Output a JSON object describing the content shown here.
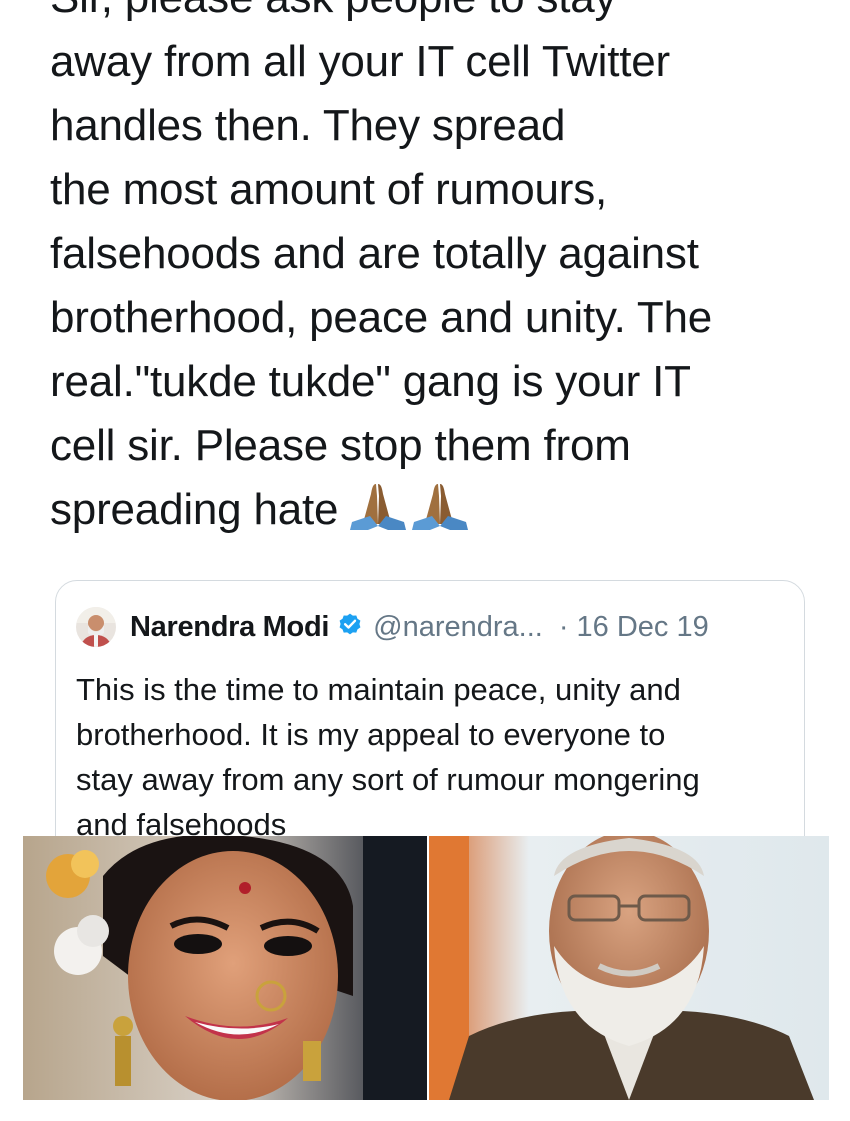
{
  "main_tweet": {
    "lines": [
      "Sir, please ask people to stay",
      "away from all your IT cell Twitter",
      "handles then. They spread",
      "the most amount of rumours,",
      "falsehoods and are totally against",
      "brotherhood, peace and unity. The",
      "real.\"tukde tukde\" gang is your IT",
      "cell sir. Please stop them from",
      "spreading hate"
    ],
    "emoji": "folded-hands-icon",
    "emoji_count": 2
  },
  "quoted_tweet": {
    "name": "Narendra Modi",
    "verified": true,
    "handle": "@narendra...",
    "dot": "·",
    "date": "16 Dec 19",
    "lines": [
      "This is the time to maintain peace, unity and",
      "brotherhood. It is my appeal to everyone to",
      "stay away from any sort of rumour mongering",
      "and falsehoods"
    ]
  },
  "colors": {
    "text": "#14171a",
    "secondary": "#657786",
    "verified_blue": "#1da1f2",
    "border": "#d4dadf"
  }
}
